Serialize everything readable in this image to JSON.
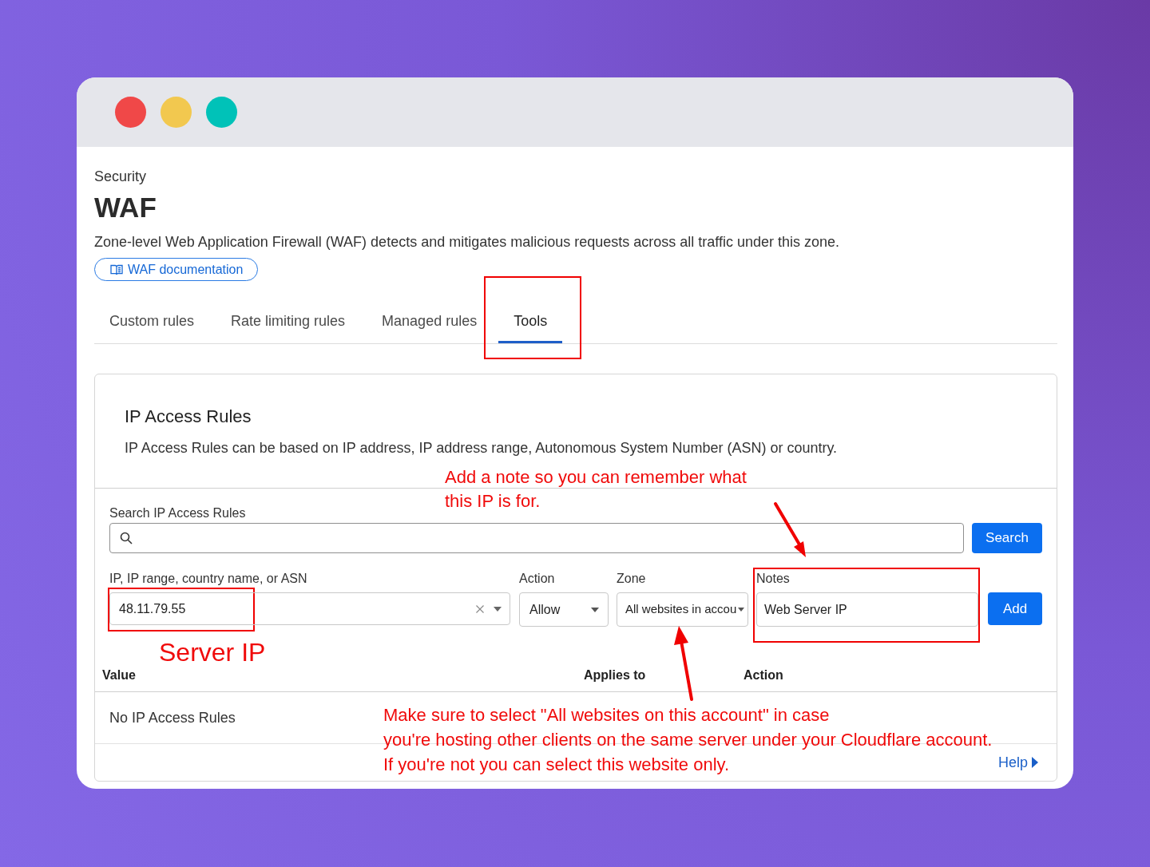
{
  "window": {
    "controls": [
      {
        "color": "#f04848"
      },
      {
        "color": "#f2c84f"
      },
      {
        "color": "#00c2b8"
      }
    ]
  },
  "header": {
    "breadcrumb": "Security",
    "title": "WAF",
    "description": "Zone-level Web Application Firewall (WAF) detects and mitigates malicious requests across all traffic under this zone.",
    "doc_link": "WAF documentation"
  },
  "tabs": [
    {
      "label": "Custom rules",
      "selected": false,
      "highlighted": false
    },
    {
      "label": "Rate limiting rules",
      "selected": false,
      "highlighted": false
    },
    {
      "label": "Managed rules",
      "selected": false,
      "highlighted": false
    },
    {
      "label": "Tools",
      "selected": true,
      "highlighted": true
    }
  ],
  "ip_access_rules": {
    "title": "IP Access Rules",
    "description": "IP Access Rules can be based on IP address, IP address range, Autonomous System Number (ASN) or country.",
    "search": {
      "label": "Search IP Access Rules",
      "button": "Search"
    },
    "form": {
      "ip": {
        "label": "IP, IP range, country name, or ASN",
        "value": "48.11.79.55",
        "highlighted": true
      },
      "action": {
        "label": "Action",
        "value": "Allow"
      },
      "zone": {
        "label": "Zone",
        "value": "All websites in accou"
      },
      "notes": {
        "label": "Notes",
        "value": "Web Server IP",
        "highlighted": true
      },
      "button": "Add"
    },
    "table": {
      "columns": [
        "Value",
        "Applies to",
        "Action"
      ],
      "empty_message": "No IP Access Rules"
    },
    "help_link": "Help"
  },
  "annotations": [
    {
      "kind": "callout",
      "lines": [
        "Add a note so you can remember what",
        "this IP is for."
      ]
    },
    {
      "kind": "label",
      "lines": [
        "Server IP"
      ]
    },
    {
      "kind": "callout",
      "lines": [
        "Make sure to select \"All websites on this account\" in case",
        "you're hosting other clients on the same server under your Cloudflare account.",
        "If you're not you can select this website only."
      ]
    }
  ]
}
